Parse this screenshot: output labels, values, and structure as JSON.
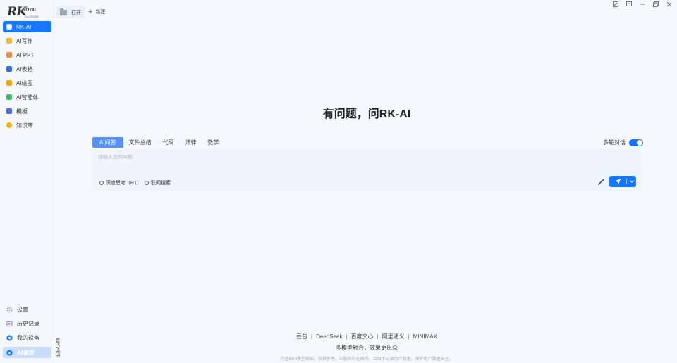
{
  "logo": {
    "main": "RK",
    "royal": "ROYAL",
    "sub": "KILOSTAR"
  },
  "sidebar": {
    "items": [
      {
        "label": "RK-AI",
        "icon": "rk-ai-icon",
        "color": "#1677ff",
        "active": true
      },
      {
        "label": "AI写作",
        "icon": "writing-icon",
        "color": "#f5b731"
      },
      {
        "label": "AI PPT",
        "icon": "ppt-icon",
        "color": "#f08a3c"
      },
      {
        "label": "AI表格",
        "icon": "table-icon",
        "color": "#2f6fe8"
      },
      {
        "label": "AI绘图",
        "icon": "drawing-icon",
        "color": "#f2a900"
      },
      {
        "label": "AI智能体",
        "icon": "agent-icon",
        "color": "#3fbf6a"
      },
      {
        "label": "模板",
        "icon": "template-icon",
        "color": "#4e6de6"
      },
      {
        "label": "知识库",
        "icon": "knowledge-icon",
        "color": "#f3b400"
      }
    ],
    "bottom": [
      {
        "label": "设置",
        "icon": "gear-icon"
      },
      {
        "label": "历史记录",
        "icon": "history-icon"
      },
      {
        "label": "我的设备",
        "icon": "device-icon"
      },
      {
        "label": "AI冒险",
        "icon": "ai-adventure-icon"
      }
    ],
    "vertical_tab": "历史记录"
  },
  "topbar": {
    "open_label": "打开",
    "new_label": "新建"
  },
  "main": {
    "headline": "有问题，问RK-AI",
    "tabs": [
      "AI问答",
      "文件总结",
      "代码",
      "法律",
      "数学"
    ],
    "multi_turn_label": "多轮对话",
    "input_placeholder": "请输入您的问题",
    "chip_deep": "深度思考（R1）",
    "chip_search": "联网搜索"
  },
  "footer": {
    "models": [
      "豆包",
      "DeepSeek",
      "百度文心",
      "阿里通义",
      "MINIMAX"
    ],
    "tagline": "多模型融合，效果更出众",
    "disclaimer": "内容由AI模型输出，仅供参考。AI服务均在国内，且由不记录用户数据，保护用户数据安全。"
  },
  "colors": {
    "accent": "#1677ff",
    "sidebar_bg": "#f4f7fc",
    "page_bg": "#f6f8fd"
  }
}
